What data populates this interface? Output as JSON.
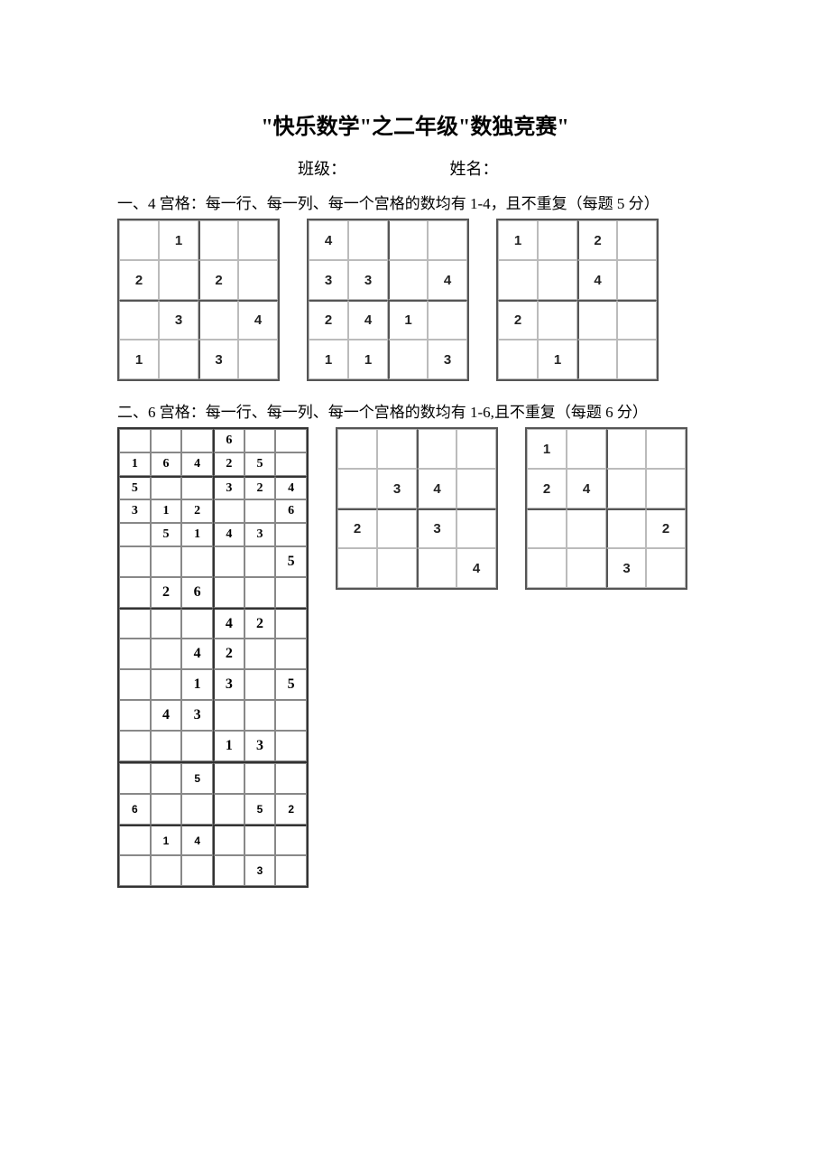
{
  "title": "\"快乐数学\"之二年级\"数独竞赛\"",
  "form": {
    "class_label": "班级：",
    "name_label": "姓名："
  },
  "section1": {
    "heading": "一、4 宫格：每一行、每一列、每一个宫格的数均有 1-4，且不重复（每题 5 分）",
    "grids": [
      [
        [
          "",
          "1",
          "",
          ""
        ],
        [
          "2",
          "",
          "2",
          ""
        ],
        [
          "",
          "3",
          "",
          "4"
        ],
        [
          "1",
          "",
          "3",
          ""
        ]
      ],
      [
        [
          "4",
          "",
          "",
          ""
        ],
        [
          "3",
          "3",
          "",
          "4"
        ],
        [
          "2",
          "4",
          "1",
          ""
        ],
        [
          "1",
          "1",
          "",
          "3"
        ]
      ],
      [
        [
          "1",
          "",
          "2",
          ""
        ],
        [
          "",
          "",
          "4",
          ""
        ],
        [
          "2",
          "",
          "",
          ""
        ],
        [
          "",
          "1",
          "",
          ""
        ]
      ]
    ]
  },
  "section2": {
    "heading": "二、6 宫格：每一行、每一列、每一个宫格的数均有 1-6,且不重复（每题 6 分）",
    "gridA_top": [
      [
        "",
        "",
        "",
        "6",
        "",
        ""
      ],
      [
        "1",
        "6",
        "4",
        "2",
        "5",
        ""
      ],
      [
        "5",
        "",
        "",
        "3",
        "2",
        "4"
      ],
      [
        "3",
        "1",
        "2",
        "",
        "",
        "6"
      ],
      [
        "",
        "5",
        "1",
        "4",
        "3",
        ""
      ]
    ],
    "gridA_mid": [
      [
        "",
        "",
        "",
        "",
        "",
        "5"
      ],
      [
        "",
        "2",
        "6",
        "",
        "",
        ""
      ],
      [
        "",
        "",
        "",
        "4",
        "2",
        ""
      ],
      [
        "",
        "",
        "4",
        "2",
        "",
        ""
      ],
      [
        "",
        "",
        "1",
        "3",
        "",
        "5"
      ],
      [
        "",
        "4",
        "3",
        "",
        "",
        ""
      ],
      [
        "",
        "",
        "",
        "1",
        "3",
        ""
      ]
    ],
    "gridA_bot": [
      [
        "",
        "",
        "5",
        "",
        "",
        ""
      ],
      [
        "6",
        "",
        "",
        "",
        "5",
        "2"
      ],
      [
        "",
        "1",
        "4",
        "",
        "",
        ""
      ],
      [
        "",
        "",
        "",
        "",
        "3",
        ""
      ]
    ],
    "gridB": [
      [
        "",
        "",
        "",
        ""
      ],
      [
        "",
        "3",
        "4",
        ""
      ],
      [
        "2",
        "",
        "3",
        ""
      ],
      [
        "",
        "",
        "",
        "4"
      ]
    ],
    "gridC": [
      [
        "1",
        "",
        "",
        ""
      ],
      [
        "2",
        "4",
        "",
        ""
      ],
      [
        "",
        "",
        "",
        "2"
      ],
      [
        "",
        "",
        "3",
        ""
      ]
    ]
  }
}
